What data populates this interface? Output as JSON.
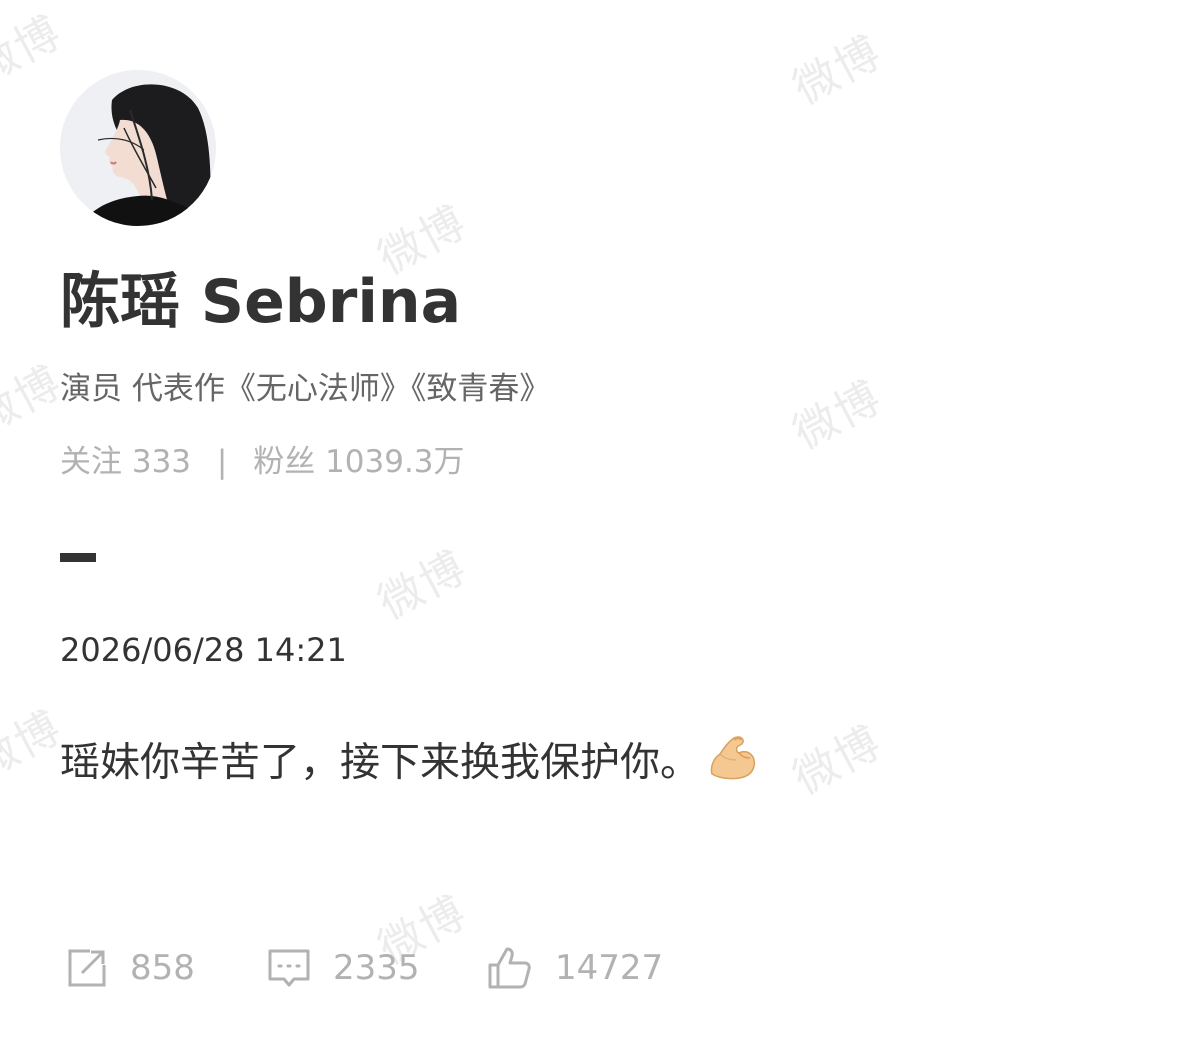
{
  "watermark": "微博",
  "profile": {
    "name": "陈瑶 Sebrina",
    "bio": "演员 代表作《无心法师》《致青春》",
    "following_label": "关注",
    "following_count": "333",
    "separator": "|",
    "followers_label": "粉丝",
    "followers_count": "1039.3万"
  },
  "post": {
    "timestamp": "2026/06/28 14:21",
    "text": "瑶妹你辛苦了，接下来换我保护你。",
    "emoji": "flexed-biceps-icon"
  },
  "actions": {
    "repost_count": "858",
    "comment_count": "2335",
    "like_count": "14727"
  },
  "colors": {
    "text_primary": "#333333",
    "text_secondary": "#666666",
    "text_muted": "#b2b2b2",
    "icon": "#b2b2b2"
  }
}
